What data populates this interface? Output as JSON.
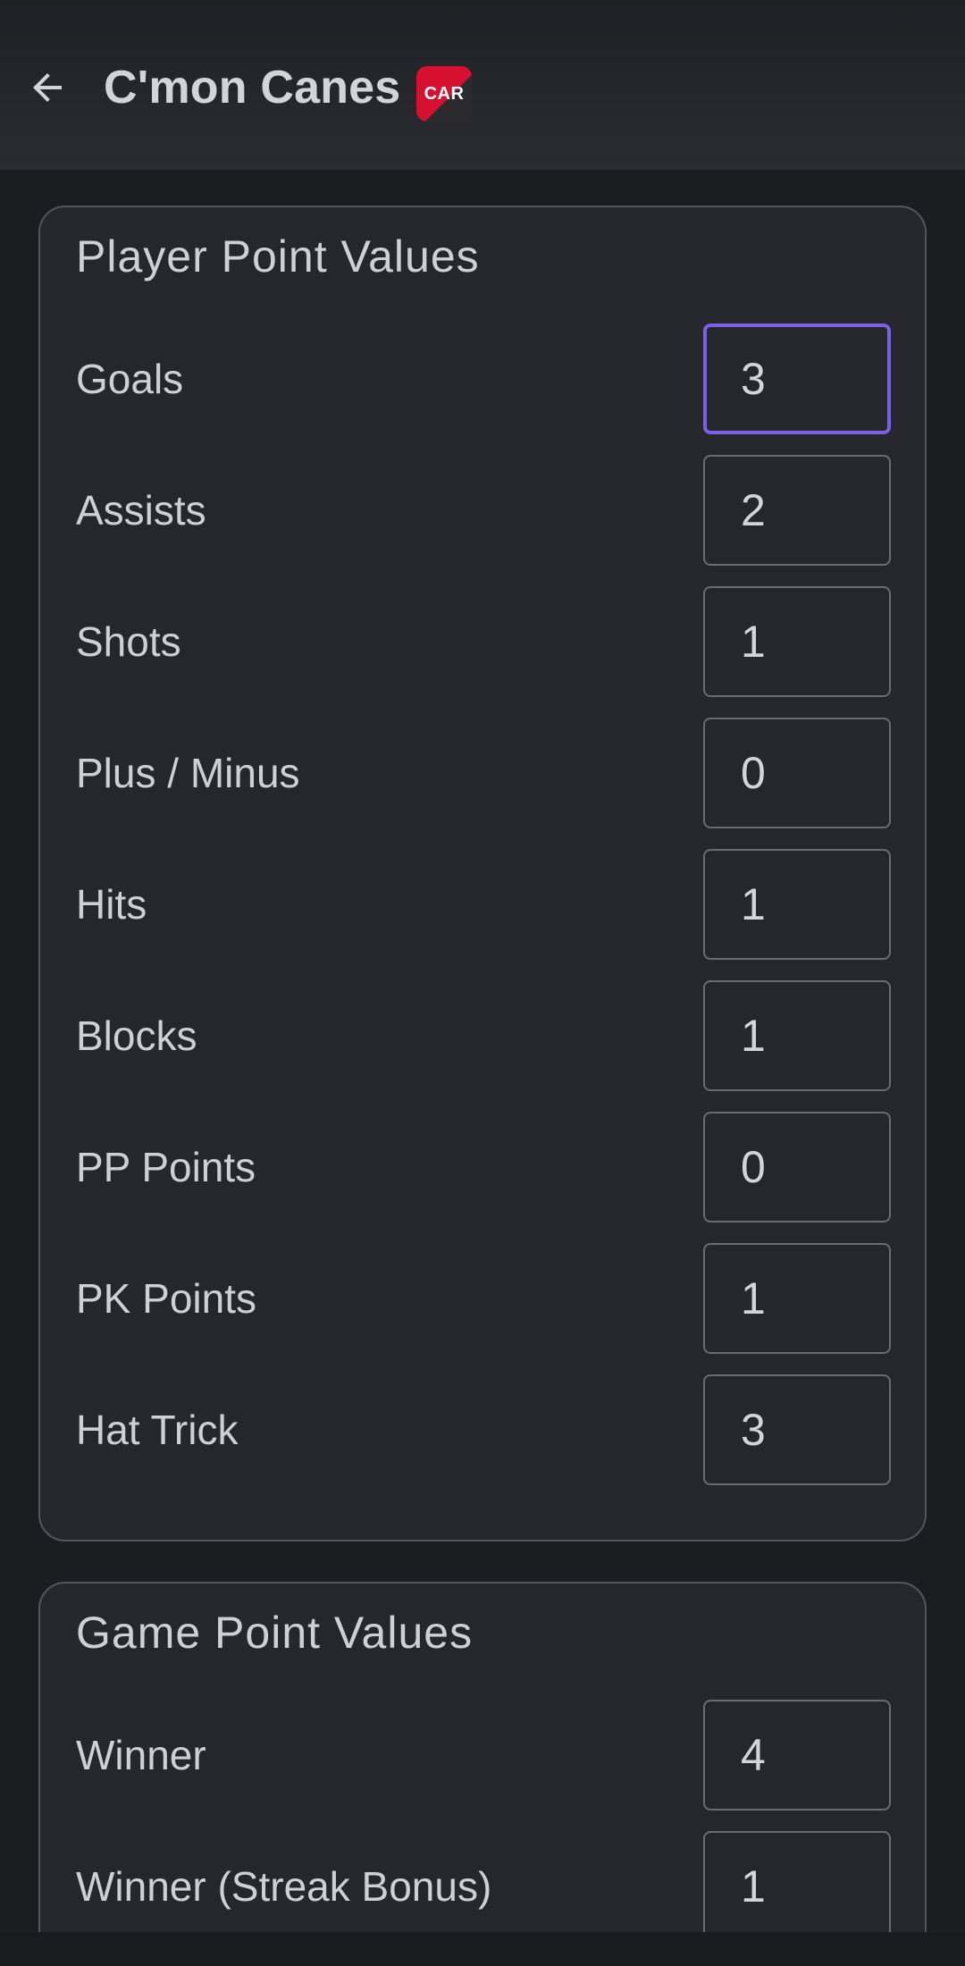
{
  "header": {
    "title": "C'mon Canes",
    "logo_text": "CAR",
    "back_icon": "arrow-left-icon"
  },
  "player_section": {
    "title": "Player Point Values",
    "rows": [
      {
        "label": "Goals",
        "value": "3",
        "focused": true
      },
      {
        "label": "Assists",
        "value": "2"
      },
      {
        "label": "Shots",
        "value": "1"
      },
      {
        "label": "Plus / Minus",
        "value": "0"
      },
      {
        "label": "Hits",
        "value": "1"
      },
      {
        "label": "Blocks",
        "value": "1"
      },
      {
        "label": "PP Points",
        "value": "0"
      },
      {
        "label": "PK Points",
        "value": "1"
      },
      {
        "label": "Hat Trick",
        "value": "3"
      }
    ]
  },
  "game_section": {
    "title": "Game Point Values",
    "rows": [
      {
        "label": "Winner",
        "value": "4"
      },
      {
        "label": "Winner (Streak Bonus)",
        "value": "1"
      }
    ]
  },
  "colors": {
    "background": "#1c1d21",
    "card": "#26272c",
    "focus_border": "#7c5ee8",
    "logo_red": "#d7102f"
  }
}
